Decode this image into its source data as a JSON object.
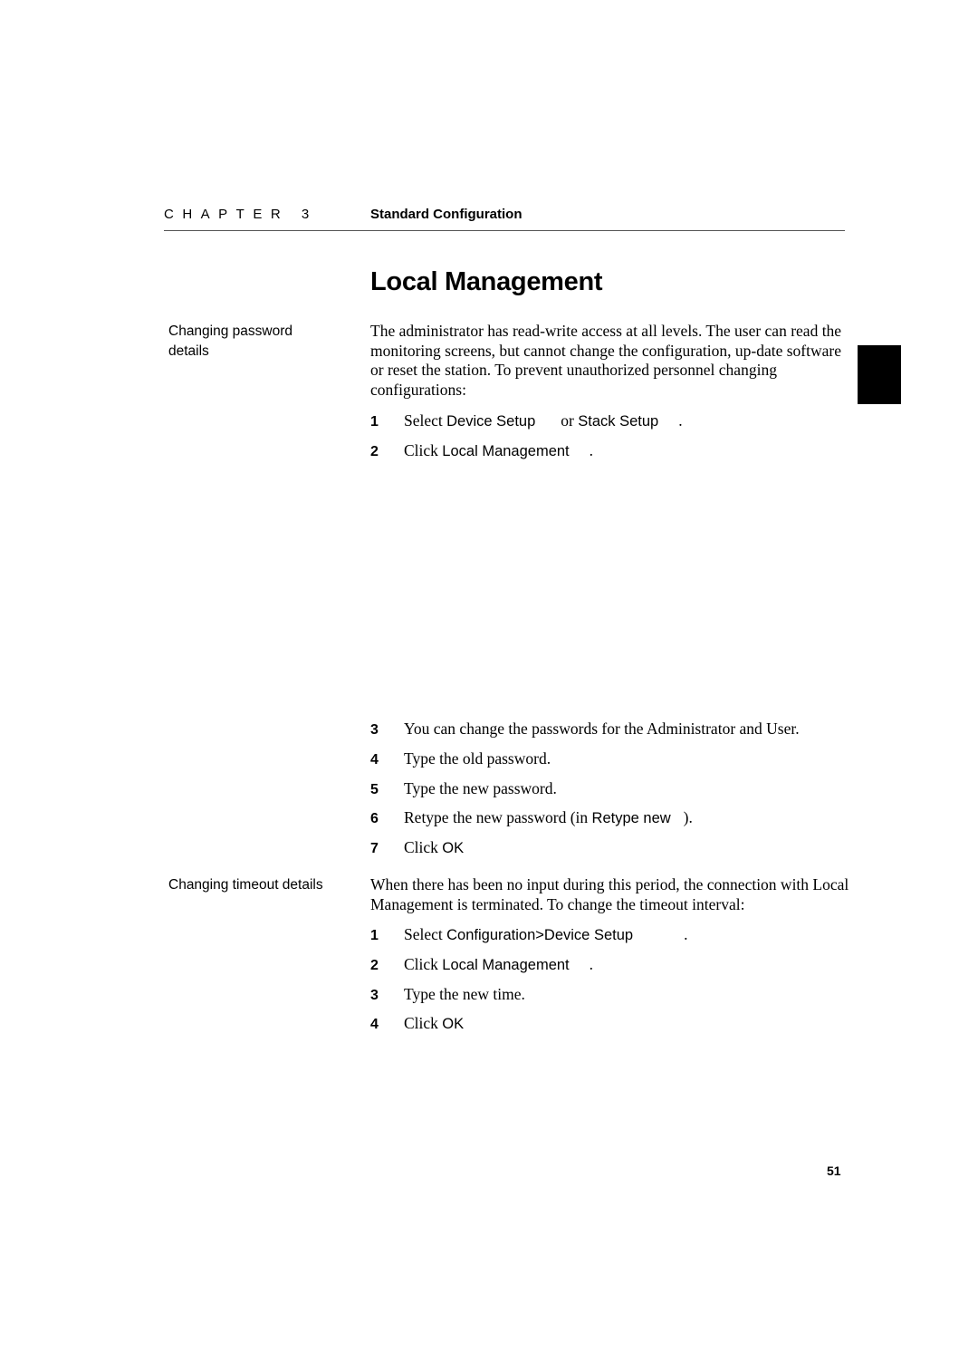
{
  "header": {
    "chapter_label": "CHAPTER 3",
    "chapter_title": "Standard Configuration"
  },
  "page_title": "Local Management",
  "sections": [
    {
      "side_label": "Changing password details",
      "intro": "The administrator has read-write access at all levels. The user can read the monitoring screens, but cannot change the configuration, up-date software or reset the station. To prevent unauthorized personnel changing configurations:",
      "steps_part1": [
        {
          "num": "1",
          "prefix": "Select ",
          "ui1": "Device Setup",
          "mid": "or ",
          "ui2": "Stack Setup",
          "suffix": "."
        },
        {
          "num": "2",
          "prefix": "Click ",
          "ui1": "Local Management",
          "suffix": "."
        }
      ],
      "steps_part2": [
        {
          "num": "3",
          "text": "You can change the passwords for the Administrator and User."
        },
        {
          "num": "4",
          "text": "Type the old password."
        },
        {
          "num": "5",
          "text": "Type the new password."
        },
        {
          "num": "6",
          "prefix": "Retype the new password (in ",
          "ui1": "Retype new",
          "suffix": ")."
        },
        {
          "num": "7",
          "prefix": "Click ",
          "ui1": "OK"
        }
      ]
    },
    {
      "side_label": "Changing timeout details",
      "intro": "When there has been no input during this period, the connection with Local Management is terminated. To change the timeout interval:",
      "steps": [
        {
          "num": "1",
          "prefix": "Select ",
          "ui1": "Configuration>Device Setup",
          "suffix": "."
        },
        {
          "num": "2",
          "prefix": "Click ",
          "ui1": "Local Management",
          "suffix": "."
        },
        {
          "num": "3",
          "text": "Type the new time."
        },
        {
          "num": "4",
          "prefix": "Click ",
          "ui1": "OK"
        }
      ]
    }
  ],
  "page_number": "51"
}
